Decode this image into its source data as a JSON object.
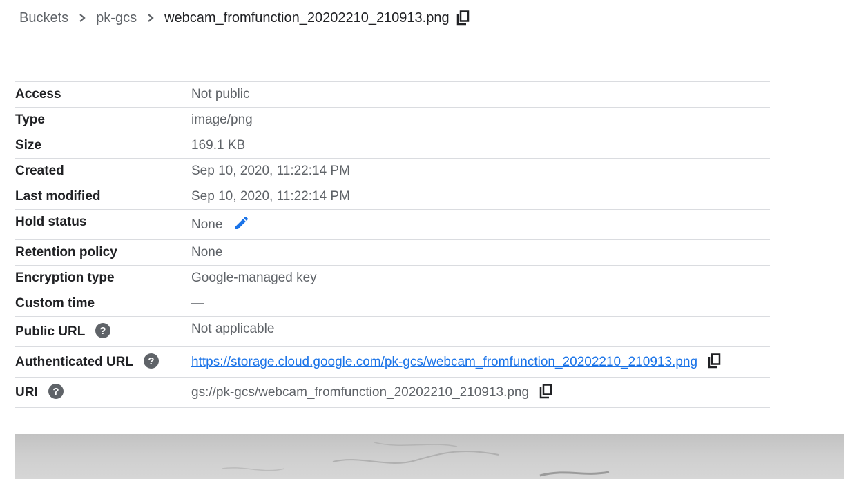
{
  "breadcrumb": {
    "items": [
      "Buckets",
      "pk-gcs"
    ],
    "current": "webcam_fromfunction_20202210_210913.png"
  },
  "details": {
    "access": {
      "label": "Access",
      "value": "Not public"
    },
    "type": {
      "label": "Type",
      "value": "image/png"
    },
    "size": {
      "label": "Size",
      "value": "169.1 KB"
    },
    "created": {
      "label": "Created",
      "value": "Sep 10, 2020, 11:22:14 PM"
    },
    "last_modified": {
      "label": "Last modified",
      "value": "Sep 10, 2020, 11:22:14 PM"
    },
    "hold_status": {
      "label": "Hold status",
      "value": "None"
    },
    "retention_policy": {
      "label": "Retention policy",
      "value": "None"
    },
    "encryption_type": {
      "label": "Encryption type",
      "value": "Google-managed key"
    },
    "custom_time": {
      "label": "Custom time",
      "value": "—"
    },
    "public_url": {
      "label": "Public URL",
      "value": "Not applicable"
    },
    "authenticated_url": {
      "label": "Authenticated URL",
      "value": "https://storage.cloud.google.com/pk-gcs/webcam_fromfunction_20202210_210913.png"
    },
    "uri": {
      "label": "URI",
      "value": "gs://pk-gcs/webcam_fromfunction_20202210_210913.png"
    }
  },
  "colors": {
    "link": "#1a73e8",
    "label": "#202124",
    "value": "#5f6368",
    "divider": "#dadce0"
  },
  "icons": [
    "chevron-right-icon",
    "copy-icon",
    "edit-icon",
    "help-icon"
  ]
}
